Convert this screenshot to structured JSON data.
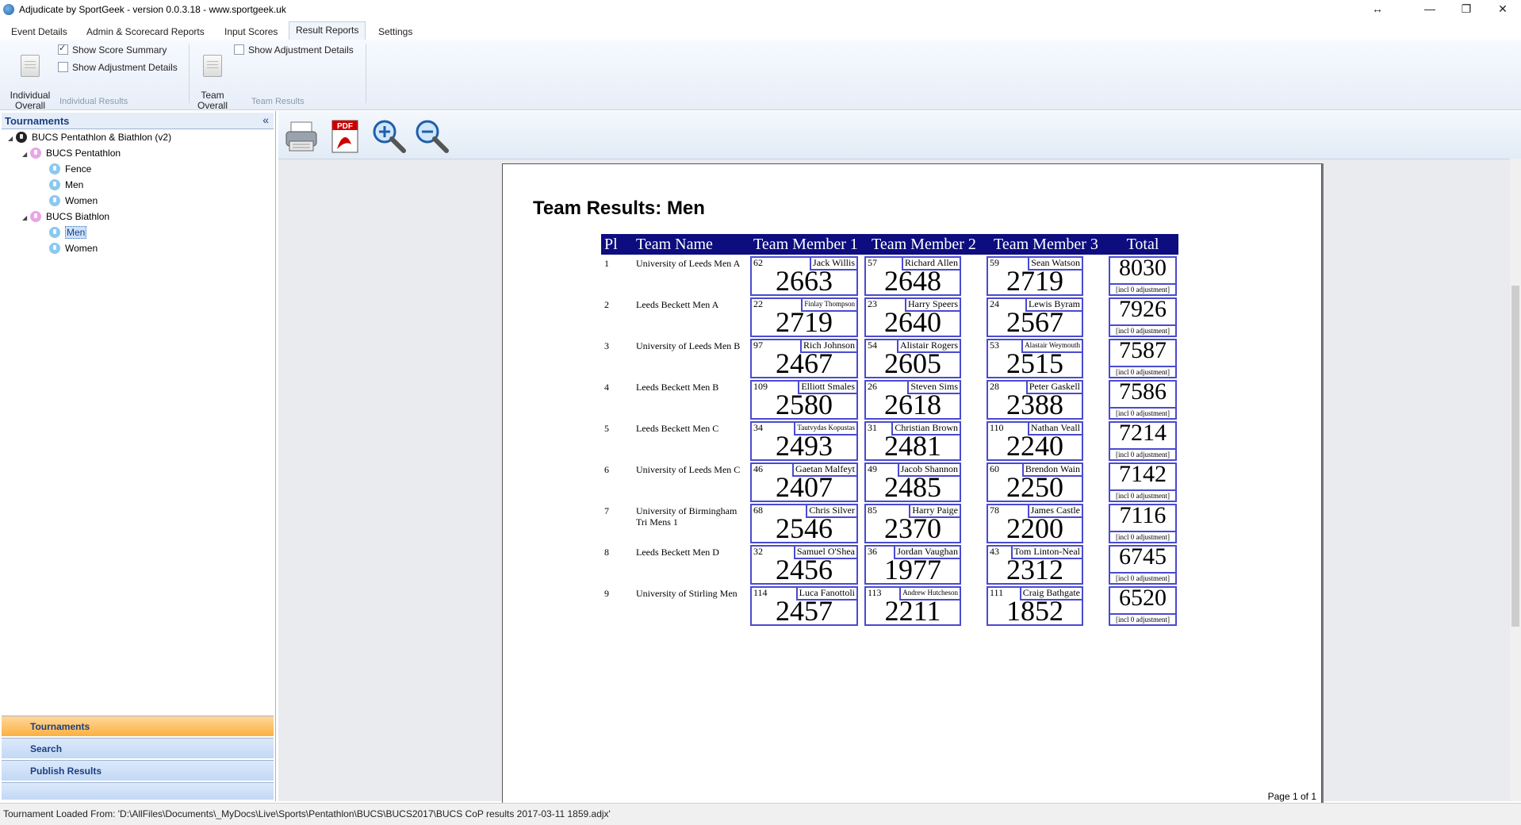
{
  "window": {
    "title": "Adjudicate by SportGeek -  version 0.0.3.18 - www.sportgeek.uk",
    "controls": [
      "↔",
      "—",
      "❐",
      "✕"
    ]
  },
  "ribbon": {
    "tabs": [
      "Event Details",
      "Admin & Scorecard Reports",
      "Input Scores",
      "Result Reports",
      "Settings"
    ],
    "active_tab": "Result Reports",
    "individual_overall": "Individual\nOverall",
    "show_score_summary": "Show Score Summary",
    "show_adjustment_details": "Show Adjustment Details",
    "individual_results_group": "Individual Results",
    "team_overall": "Team\nOverall",
    "team_show_adjustment_details": "Show Adjustment Details",
    "team_results_group": "Team Results"
  },
  "sidebar": {
    "header": "Tournaments",
    "collapse": "«",
    "tree": {
      "root": "BUCS Pentathlon & Biathlon (v2)",
      "pentathlon": "BUCS Pentathlon",
      "pentathlon_children": [
        "Fence",
        "Men",
        "Women"
      ],
      "biathlon": "BUCS Biathlon",
      "biathlon_children": [
        "Men",
        "Women"
      ]
    },
    "nav": [
      "Tournaments",
      "Search",
      "Publish Results"
    ]
  },
  "report": {
    "title": "Team Results: Men",
    "headers": [
      "Pl",
      "Team Name",
      "Team Member 1",
      "Team Member 2",
      "Team Member 3",
      "Total"
    ],
    "adjustment_text": "[incl 0 adjustment]",
    "rows": [
      {
        "pl": "1",
        "team": "University of Leeds Men A",
        "members": [
          {
            "num": "62",
            "name": "Jack Willis",
            "score": "2663"
          },
          {
            "num": "57",
            "name": "Richard Allen",
            "score": "2648"
          },
          {
            "num": "59",
            "name": "Sean Watson",
            "score": "2719"
          }
        ],
        "total": "8030"
      },
      {
        "pl": "2",
        "team": "Leeds Beckett Men A",
        "members": [
          {
            "num": "22",
            "name": "Finlay Thompson",
            "score": "2719",
            "small": true
          },
          {
            "num": "23",
            "name": "Harry Speers",
            "score": "2640"
          },
          {
            "num": "24",
            "name": "Lewis Byram",
            "score": "2567"
          }
        ],
        "total": "7926"
      },
      {
        "pl": "3",
        "team": "University of Leeds Men B",
        "members": [
          {
            "num": "97",
            "name": "Rich Johnson",
            "score": "2467"
          },
          {
            "num": "54",
            "name": "Alistair Rogers",
            "score": "2605"
          },
          {
            "num": "53",
            "name": "Alastair Weymouth",
            "score": "2515",
            "small": true
          }
        ],
        "total": "7587"
      },
      {
        "pl": "4",
        "team": "Leeds Beckett Men B",
        "members": [
          {
            "num": "109",
            "name": "Elliott Smales",
            "score": "2580"
          },
          {
            "num": "26",
            "name": "Steven Sims",
            "score": "2618"
          },
          {
            "num": "28",
            "name": "Peter Gaskell",
            "score": "2388"
          }
        ],
        "total": "7586"
      },
      {
        "pl": "5",
        "team": "Leeds Beckett Men C",
        "members": [
          {
            "num": "34",
            "name": "Tautvydas Kopustas",
            "score": "2493",
            "small": true
          },
          {
            "num": "31",
            "name": "Christian Brown",
            "score": "2481"
          },
          {
            "num": "110",
            "name": "Nathan Veall",
            "score": "2240"
          }
        ],
        "total": "7214"
      },
      {
        "pl": "6",
        "team": "University of Leeds Men C",
        "members": [
          {
            "num": "46",
            "name": "Gaetan Malfeyt",
            "score": "2407"
          },
          {
            "num": "49",
            "name": "Jacob Shannon",
            "score": "2485"
          },
          {
            "num": "60",
            "name": "Brendon Wain",
            "score": "2250"
          }
        ],
        "total": "7142"
      },
      {
        "pl": "7",
        "team": "University of Birmingham Tri Mens 1",
        "members": [
          {
            "num": "68",
            "name": "Chris Silver",
            "score": "2546"
          },
          {
            "num": "85",
            "name": "Harry Paige",
            "score": "2370"
          },
          {
            "num": "78",
            "name": "James Castle",
            "score": "2200"
          }
        ],
        "total": "7116"
      },
      {
        "pl": "8",
        "team": "Leeds Beckett Men D",
        "members": [
          {
            "num": "32",
            "name": "Samuel O'Shea",
            "score": "2456"
          },
          {
            "num": "36",
            "name": "Jordan Vaughan",
            "score": "1977"
          },
          {
            "num": "43",
            "name": "Tom Linton-Neal",
            "score": "2312"
          }
        ],
        "total": "6745"
      },
      {
        "pl": "9",
        "team": "University of Stirling Men",
        "members": [
          {
            "num": "114",
            "name": "Luca Fanottoli",
            "score": "2457"
          },
          {
            "num": "113",
            "name": "Andrew Hutcheson",
            "score": "2211",
            "small": true
          },
          {
            "num": "111",
            "name": "Craig Bathgate",
            "score": "1852"
          }
        ],
        "total": "6520"
      }
    ],
    "page_indicator": "Page 1 of 1"
  },
  "status": {
    "text": "Tournament Loaded From: 'D:\\AllFiles\\Documents\\_MyDocs\\Live\\Sports\\Pentathlon\\BUCS\\BUCS2017\\BUCS CoP results 2017-03-11 1859.adjx'"
  }
}
